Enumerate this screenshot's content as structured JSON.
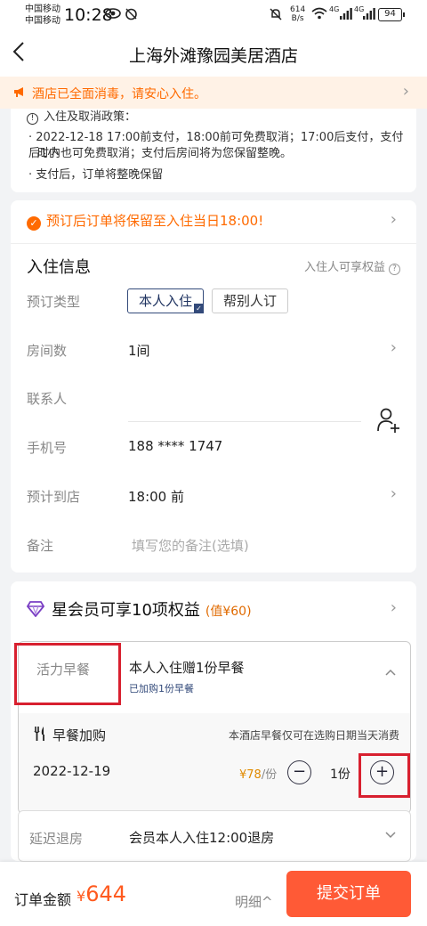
{
  "status_bar": {
    "carrier1": "中国移动",
    "carrier2": "中国移动",
    "time": "10:28",
    "net_speed": "614",
    "net_unit": "B/s",
    "signal1": "4G",
    "signal2": "4G",
    "battery": "94"
  },
  "nav": {
    "back": "‹",
    "title": "上海外滩豫园美居酒店"
  },
  "notice": {
    "text": "酒店已全面消毒，请安心入住。",
    "arrow": "›",
    "color": "#ff6a00"
  },
  "policy": {
    "heading": "入住及取消政策：",
    "line1": "· 2022-12-18 17:00前支付，18:00前可免费取消；17:00后支付，支付后1小",
    "line2": "时内也可免费取消；支付后房间将为您保留整晚。",
    "line3": "· 支付后，订单将整晚保留"
  },
  "booking": {
    "guarantee": "预订后订单将保留至入住当日18:00!",
    "section_title": "入住信息",
    "benefit_tip": "入住人可享权益",
    "type_label": "预订类型",
    "type_options": [
      "本人入住",
      "帮别人订"
    ],
    "rooms_label": "房间数",
    "rooms_value": "1间",
    "contact_label": "联系人",
    "contact_value": "",
    "phone_label": "手机号",
    "phone_value": "188 **** 1747",
    "arrival_label": "预计到店",
    "arrival_value": "18:00 前",
    "remark_label": "备注",
    "remark_placeholder": "填写您的备注(选填)"
  },
  "member": {
    "title": "星会员可享10项权益",
    "value": "(值¥60)",
    "breakfast_label": "活力早餐",
    "breakfast_main": "本人入住赠1份早餐",
    "breakfast_sub": "已加购1份早餐",
    "addon_title": "早餐加购",
    "addon_note": "本酒店早餐仅可在选购日期当天消费",
    "addon_date": "2022-12-19",
    "addon_price": "¥78",
    "addon_unit": "/份",
    "addon_qty": "1份",
    "late_label": "延迟退房",
    "late_value": "会员本人入住12:00退房"
  },
  "bottom": {
    "total_label": "订单金额",
    "currency": "¥",
    "total": "644",
    "detail": "明细",
    "submit": "提交订单",
    "accent": "#ff5a36"
  }
}
